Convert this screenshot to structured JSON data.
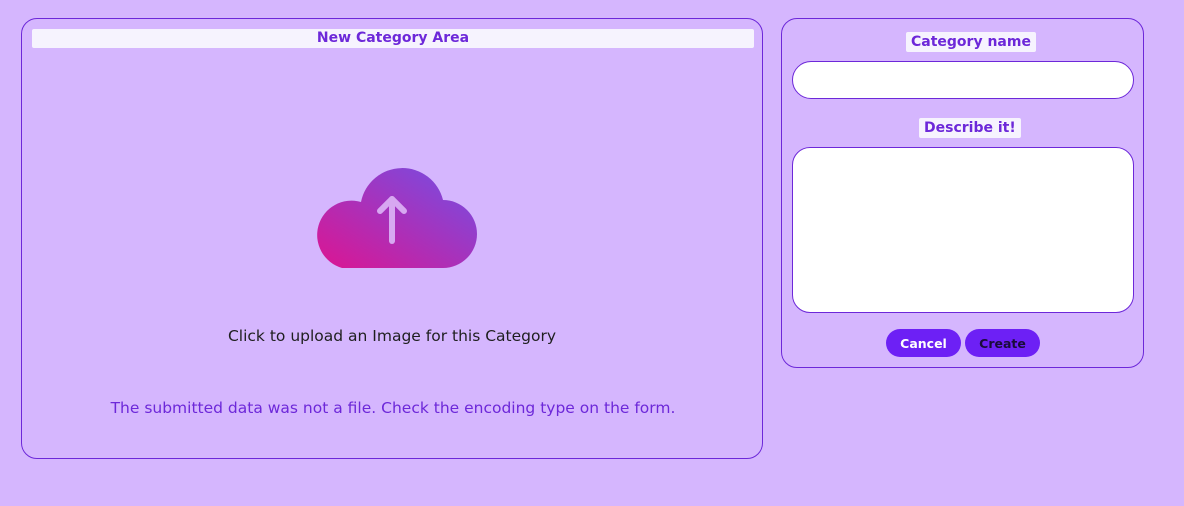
{
  "upload_area": {
    "title": "New Category Area",
    "upload_prompt": "Click to upload an Image for this Category",
    "error_message": "The submitted data was not a file. Check the encoding type on the form.",
    "icon": "cloud-upload-icon"
  },
  "form": {
    "name_label": "Category name",
    "name_value": "",
    "description_label": "Describe it!",
    "description_value": "",
    "cancel_label": "Cancel",
    "create_label": "Create"
  },
  "colors": {
    "background": "#d5b6fe",
    "accent": "#6d28d9",
    "button": "#6d20f5",
    "icon_gradient_start": "#dc1592",
    "icon_gradient_end": "#7150e6"
  }
}
